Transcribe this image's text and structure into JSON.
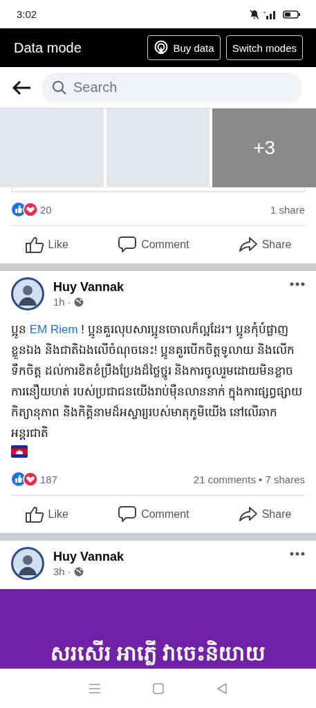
{
  "status_bar": {
    "time": "3:02"
  },
  "data_bar": {
    "title": "Data mode",
    "buttons": [
      {
        "label": "Buy data",
        "kind": "signal"
      },
      {
        "label": "Switch modes",
        "kind": "plain"
      }
    ]
  },
  "search": {
    "placeholder": "Search"
  },
  "posts": [
    {
      "kind": "partial",
      "photos": [
        {
          "kind": "photo"
        },
        {
          "kind": "photo"
        },
        {
          "kind": "more",
          "overlay": "+3"
        }
      ],
      "reactions": "20",
      "stats": "1 share",
      "actions": [
        "Like",
        "Comment",
        "Share"
      ]
    },
    {
      "kind": "full",
      "author": "Huy Vannak",
      "time": "1h ·",
      "text_before": "ប្អូន ",
      "mention": "EM Riem",
      "text_after": " ! ប្អូនគួរលុបសារប្អូនចោលក៏ល្អដែរ។ ប្អូនកុំបំផ្លាញខ្លួនឯង និងជាតិឯងលើចំណុចនេះ! ប្អូនគួរបើកចិត្តទូលាយ និងលើកទឹកចិត្ត ដល់ការខិតខំប្រឹងប្រែងដ៏ថ្លៃថ្នូរ និងការចូលរួមដោយមិនខ្លាចការនឿយហត់ របស់ប្រជាជនយើងរាប់ម៉ឺនលាននាក់ ក្នុងការផ្សព្វផ្សាយកិត្យានុភាព និងកិត្តិនាមដ៏អស្ចារ្យរបស់មាតុភូមិយើង នៅលើឆាកអន្តរជាតិ",
      "reactions": "187",
      "stats": "21 comments • 7 shares",
      "actions": [
        "Like",
        "Comment",
        "Share"
      ]
    },
    {
      "kind": "banner",
      "author": "Huy Vannak",
      "time": "3h ·",
      "banner": "សរសើរ អាភ្លើ វាចេះនិយាយ"
    }
  ]
}
